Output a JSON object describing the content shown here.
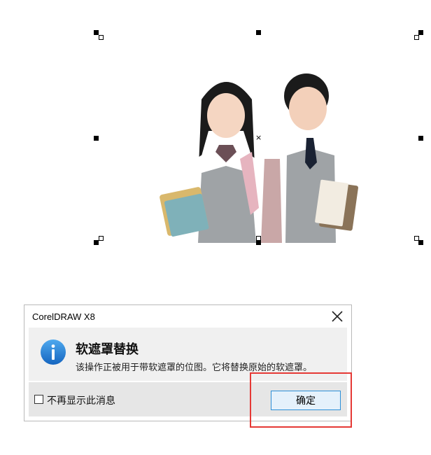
{
  "canvas": {
    "image_description_icon": "students-photo",
    "center_marker": "×"
  },
  "dialog": {
    "title": "CorelDRAW X8",
    "close_icon": "close-icon",
    "info_icon": "info-icon",
    "heading": "软遮罩替换",
    "message": "该操作正被用于带软遮罩的位图。它将替换原始的软遮罩。",
    "checkbox_label": "不再显示此消息",
    "checkbox_checked": false,
    "ok_label": "确定"
  },
  "colors": {
    "accent": "#1e88e5",
    "highlight": "#e53935"
  }
}
